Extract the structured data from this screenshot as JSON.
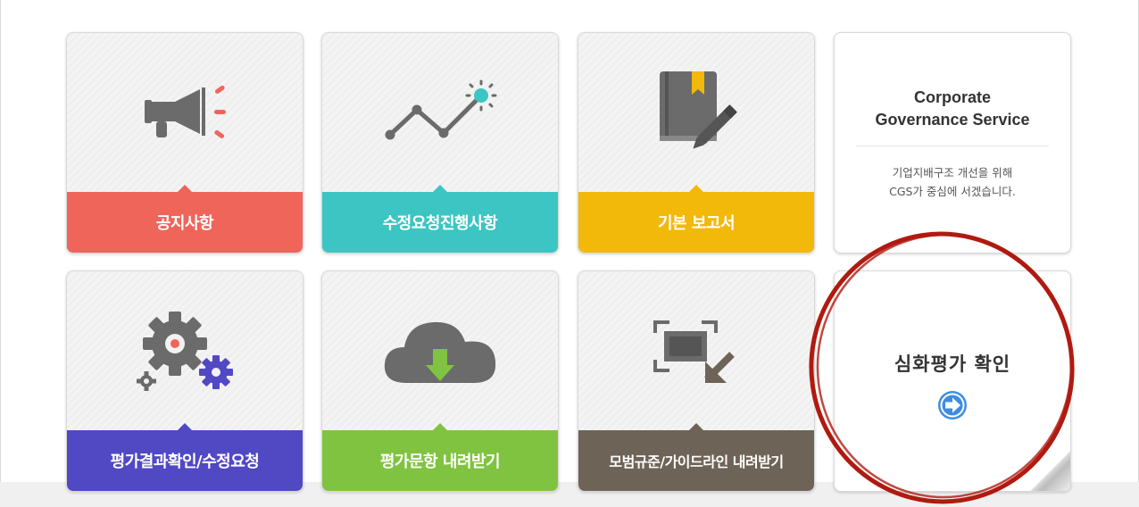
{
  "tiles_row1": [
    {
      "label": "공지사항",
      "icon": "megaphone-icon",
      "band_color": "#f0655a"
    },
    {
      "label": "수정요청진행사항",
      "icon": "trend-line-icon",
      "band_color": "#3cc5c3"
    },
    {
      "label": "기본 보고서",
      "icon": "report-book-icon",
      "band_color": "#f3b90a"
    }
  ],
  "tiles_row2": [
    {
      "label": "평가결과확인/수정요청",
      "icon": "gears-icon",
      "band_color": "#5148c4"
    },
    {
      "label": "평가문항 내려받기",
      "icon": "cloud-download-icon",
      "band_color": "#80c340"
    },
    {
      "label": "모범규준/가이드라인 내려받기",
      "icon": "screen-capture-icon",
      "band_color": "#6e6357"
    }
  ],
  "info": {
    "title_line1": "Corporate",
    "title_line2": "Governance Service",
    "desc_line1": "기업지배구조 개선을 위해",
    "desc_line2": "CGS가 중심에 서겠습니다."
  },
  "cta": {
    "label": "심화평가 확인",
    "icon": "arrow-right-circle-icon",
    "arrow_color": "#3f8de0",
    "annotation_color": "#b01a10"
  }
}
